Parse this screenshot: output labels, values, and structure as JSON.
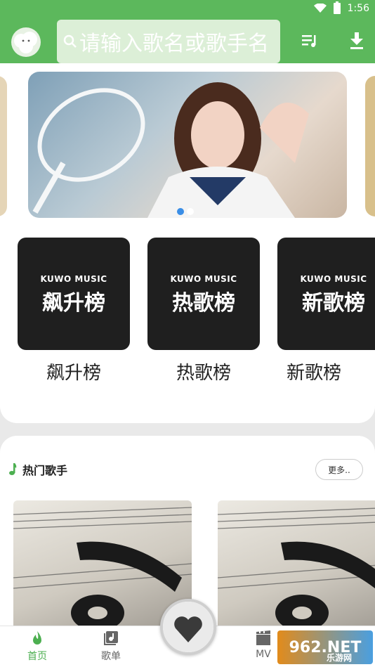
{
  "status_bar": {
    "time": "1:56"
  },
  "header": {
    "search_placeholder": "请输入歌名或歌手名",
    "logo_icon": "cloud-mascot-icon",
    "playlist_icon": "playlist-icon",
    "download_icon": "download-icon"
  },
  "banner": {
    "dots": 2,
    "active_dot": 0
  },
  "rank_lists": [
    {
      "brand": "KUWO MUSIC",
      "cover_title": "飙升榜",
      "label": "飙升榜"
    },
    {
      "brand": "KUWO MUSIC",
      "cover_title": "热歌榜",
      "label": "热歌榜"
    },
    {
      "brand": "KUWO MUSIC",
      "cover_title": "新歌榜",
      "label": "新歌榜"
    }
  ],
  "hot_singers": {
    "title": "热门歌手",
    "more_label": "更多.."
  },
  "bottom_nav": [
    {
      "label": "首页",
      "icon": "flame-icon",
      "active": true
    },
    {
      "label": "歌单",
      "icon": "music-library-icon",
      "active": false
    },
    {
      "label": "MV",
      "icon": "film-icon",
      "active": false
    }
  ],
  "watermark": {
    "text": "962.NET",
    "subtext": "乐游网"
  },
  "colors": {
    "primary": "#5cb85c",
    "active_nav": "#4caf50"
  }
}
